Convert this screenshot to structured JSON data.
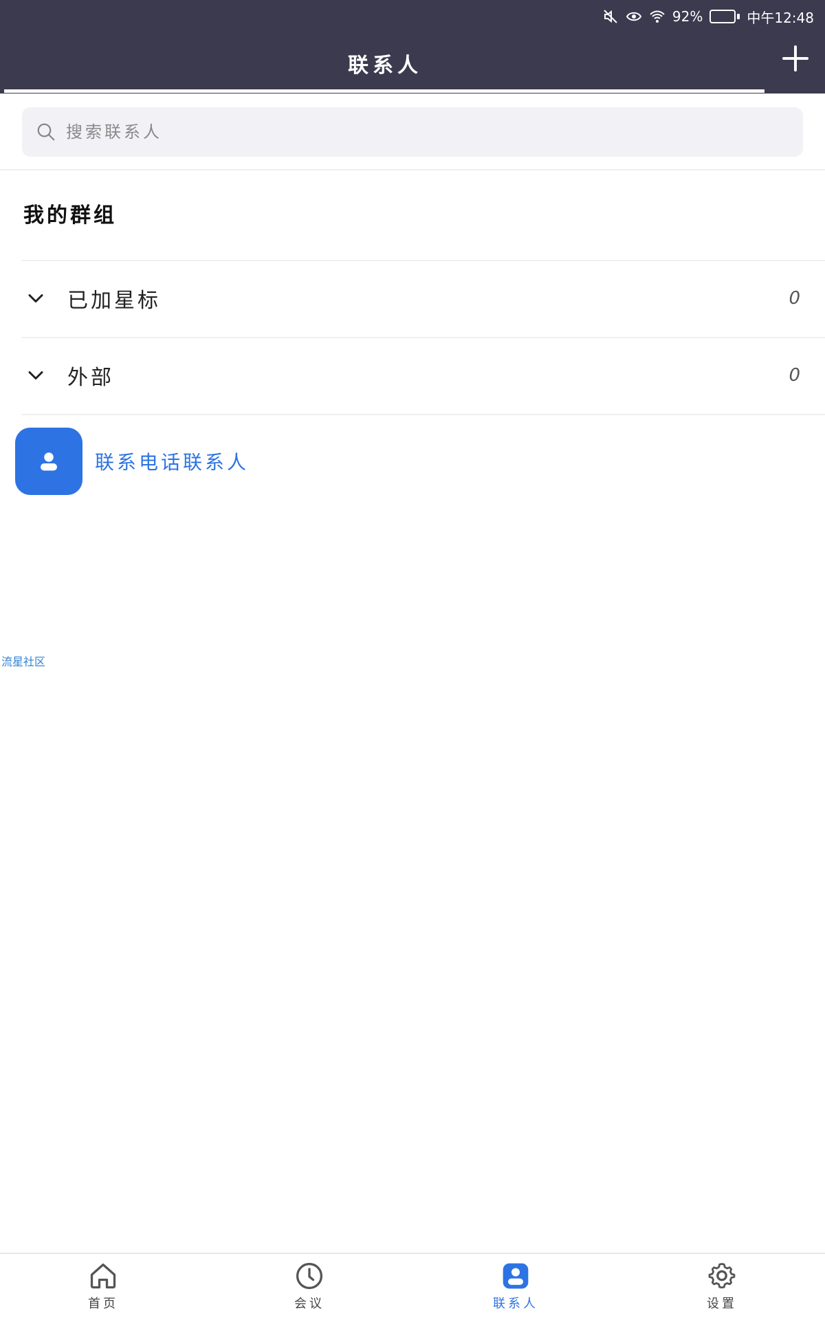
{
  "status_bar": {
    "battery": "92%",
    "time": "中午12:48",
    "icons": [
      "mute-icon",
      "eye-icon",
      "wifi-icon",
      "battery-icon"
    ]
  },
  "header": {
    "title": "联系人",
    "add_icon": "plus-icon"
  },
  "search": {
    "placeholder": "搜索联系人"
  },
  "groups": {
    "title": "我的群组",
    "items": [
      {
        "label": "已加星标",
        "count": "0"
      },
      {
        "label": "外部",
        "count": "0"
      }
    ]
  },
  "phone_contacts": {
    "label": "联系电话联系人"
  },
  "watermark": "流星社区",
  "bottom_nav": {
    "items": [
      {
        "label": "首页",
        "icon": "home-icon"
      },
      {
        "label": "会议",
        "icon": "clock-icon"
      },
      {
        "label": "联系人",
        "icon": "contacts-icon"
      },
      {
        "label": "设置",
        "icon": "gear-icon"
      }
    ],
    "active_index": 2
  },
  "colors": {
    "header_bg": "#3b3a4e",
    "accent": "#2d73e3",
    "battery_fill": "#2fd055"
  }
}
